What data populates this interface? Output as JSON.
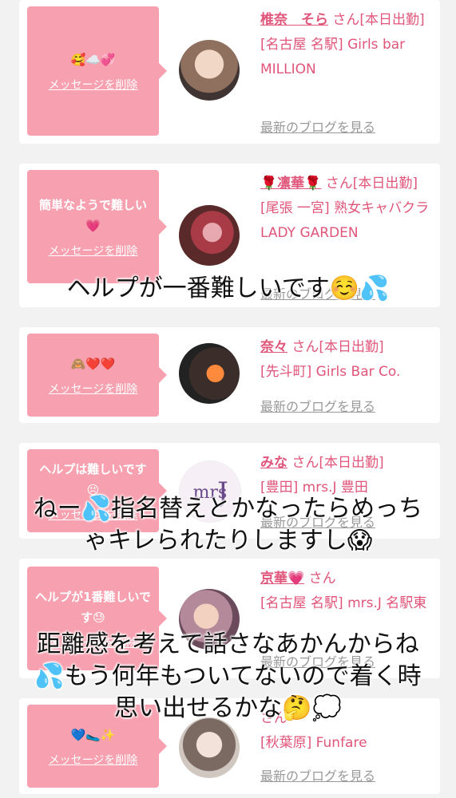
{
  "cards": [
    {
      "message": "🥰☁️💞",
      "delete_label": "メッセージを削除",
      "name": "椎奈　そら",
      "san": "さん[本日出勤]",
      "shop": "[名古屋 名駅] Girls bar MILLION",
      "blog": "最新のブログを見る"
    },
    {
      "message": "簡単なようで難しい💗",
      "delete_label": "メッセージを削除",
      "name": "🌹凛華🌹",
      "san": "さん[本日出勤]",
      "shop": "[尾張 一宮] 熟女キャバクラ LADY GARDEN",
      "blog": "最新のブログを見る"
    },
    {
      "message": "🙈❤️❤️",
      "delete_label": "メッセージを削除",
      "name": "奈々",
      "san": "さん[本日出勤]",
      "shop": "[先斗町] Girls Bar Co.",
      "blog": "最新のブログを見る"
    },
    {
      "message": "ヘルプは難しいです😣",
      "delete_label": "メッセージを削除",
      "name": "みな",
      "san": "さん[本日出勤]",
      "shop": "[豊田] mrs.J 豊田",
      "blog": "最新のブログを見る"
    },
    {
      "message": "ヘルプが1番難しいです😓",
      "delete_label": "メッセージを削除",
      "name": "京華💗",
      "san": "さん",
      "shop": "[名古屋 名駅] mrs.J 名駅東",
      "blog": "最新のブログを見る"
    },
    {
      "message": "💙🥿✨",
      "delete_label": "メッセージを削除",
      "name": "",
      "san": "さん",
      "shop": "[秋葉原] Funfare",
      "blog": "最新のブログを見る"
    }
  ],
  "captions": [
    "ヘルプが一番難しいです☺️💦",
    "ねー💦指名替えとかなったらめっち\nゃキレられたりしますし😱",
    "距離感を考えて話さなあかんからね\n💦もう何年もついてないので着く時\n思い出せるかな🤔💭"
  ],
  "colors": {
    "accent": "#f7a1b0",
    "name": "#e0557a",
    "link": "#999999"
  }
}
